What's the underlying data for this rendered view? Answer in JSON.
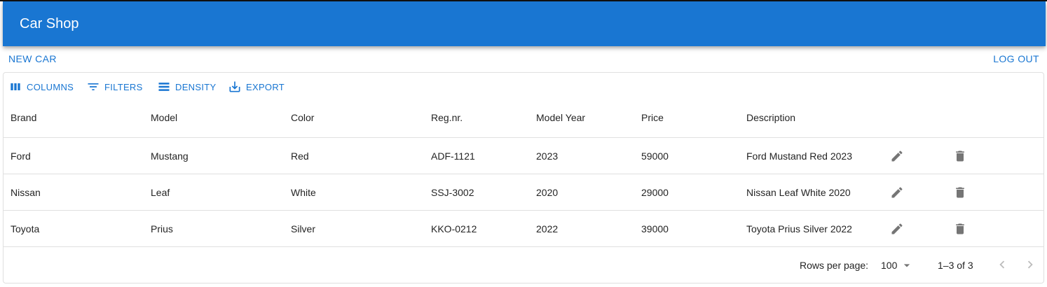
{
  "app": {
    "title": "Car Shop"
  },
  "actions": {
    "new_car": "New Car",
    "log_out": "Log out"
  },
  "toolbar": [
    {
      "label": "Columns",
      "icon": "columns-icon"
    },
    {
      "label": "Filters",
      "icon": "filter-icon"
    },
    {
      "label": "Density",
      "icon": "density-icon"
    },
    {
      "label": "Export",
      "icon": "export-icon"
    }
  ],
  "table": {
    "headers": [
      "Brand",
      "Model",
      "Color",
      "Reg.nr.",
      "Model Year",
      "Price",
      "Description"
    ],
    "rows": [
      [
        "Ford",
        "Mustang",
        "Red",
        "ADF-1121",
        "2023",
        "59000",
        "Ford Mustand Red 2023"
      ],
      [
        "Nissan",
        "Leaf",
        "White",
        "SSJ-3002",
        "2020",
        "29000",
        "Nissan Leaf White 2020"
      ],
      [
        "Toyota",
        "Prius",
        "Silver",
        "KKO-0212",
        "2022",
        "39000",
        "Toyota Prius Silver 2022"
      ]
    ],
    "row_actions": [
      "edit-icon",
      "delete-icon"
    ]
  },
  "pagination": {
    "rows_per_page_label": "Rows per page:",
    "rows_per_page_value": "100",
    "range": "1–3 of 3"
  },
  "colors": {
    "primary": "#1976d2",
    "icon_gray": "#757575",
    "border": "#e0e0e0"
  }
}
